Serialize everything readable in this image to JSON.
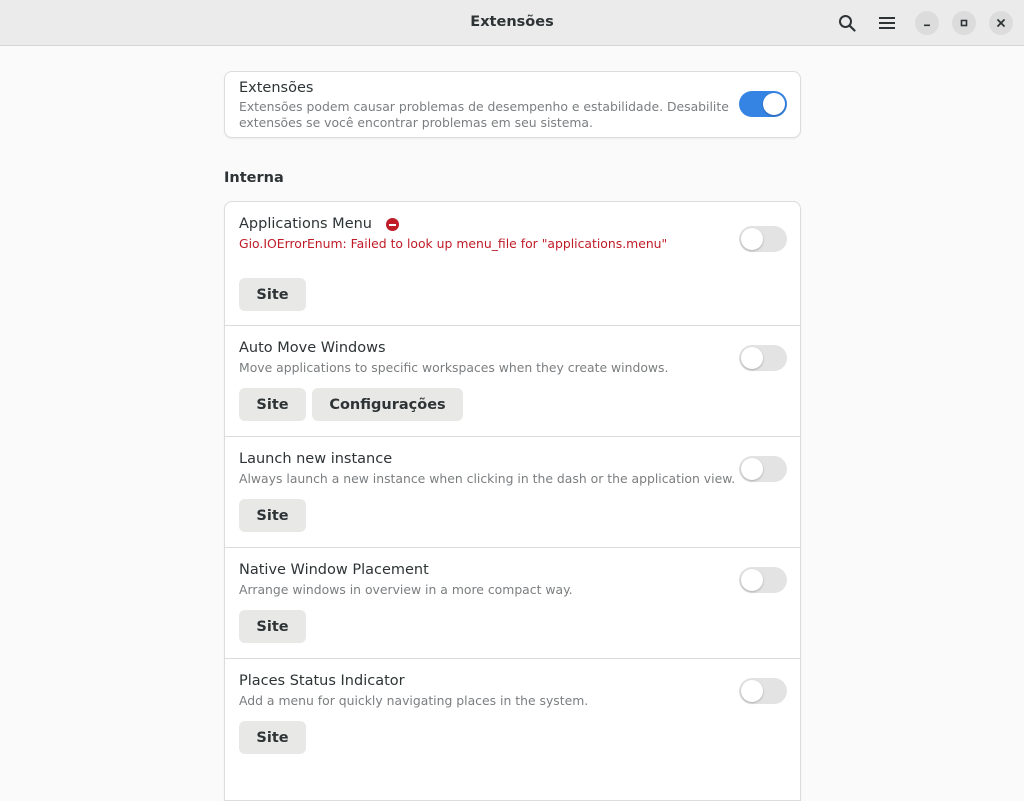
{
  "window": {
    "title": "Extensões",
    "icons": {
      "search": "search-icon",
      "menu": "hamburger-menu-icon",
      "minimize": "minimize-icon",
      "maximize": "maximize-icon",
      "close": "close-icon"
    }
  },
  "global_toggle": {
    "title": "Extensões",
    "description_line1": "Extensões podem causar problemas de desempenho e estabilidade. Desabilite",
    "description_line2": "extensões se você encontrar problemas em seu sistema.",
    "enabled": true
  },
  "section": {
    "title": "Interna"
  },
  "extensions": [
    {
      "name": "Applications Menu",
      "error": "Gio.IOErrorEnum: Failed to look up menu_file for \"applications.menu\"",
      "enabled": false,
      "buttons": [
        "Site"
      ]
    },
    {
      "name": "Auto Move Windows",
      "description": "Move applications to specific workspaces when they create windows.",
      "enabled": false,
      "buttons": [
        "Site",
        "Configurações"
      ]
    },
    {
      "name": "Launch new instance",
      "description": "Always launch a new instance when clicking in the dash or the application view.",
      "enabled": false,
      "buttons": [
        "Site"
      ]
    },
    {
      "name": "Native Window Placement",
      "description": "Arrange windows in overview in a more compact way.",
      "enabled": false,
      "buttons": [
        "Site"
      ]
    },
    {
      "name": "Places Status Indicator",
      "description": "Add a menu for quickly navigating places in the system.",
      "enabled": false,
      "buttons": [
        "Site"
      ]
    }
  ],
  "colors": {
    "accent": "#3584e4",
    "error": "#c01c28"
  }
}
